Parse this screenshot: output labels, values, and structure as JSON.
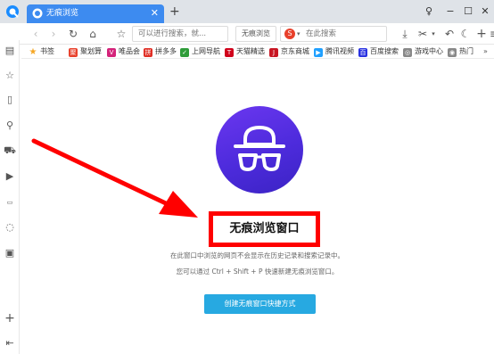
{
  "tab": {
    "title": "无痕浏览"
  },
  "toolbar": {
    "address_placeholder": "可以进行搜索，就...",
    "privacy_label": "无痕浏览",
    "search_placeholder": "在此搜索",
    "search_engine_glyph": "S"
  },
  "bookmarks": [
    {
      "label": "书签",
      "color": "#f5a623"
    },
    {
      "label": "聚划算",
      "color": "#e8402b"
    },
    {
      "label": "唯品会",
      "color": "#d4237a"
    },
    {
      "label": "拼多多",
      "color": "#e02e24"
    },
    {
      "label": "上网导航",
      "color": "#2f9c3a"
    },
    {
      "label": "天猫精选",
      "color": "#d0021b"
    },
    {
      "label": "京东商城",
      "color": "#c81623"
    },
    {
      "label": "腾讯视频",
      "color": "#20a0ff"
    },
    {
      "label": "百度搜索",
      "color": "#2932e1"
    },
    {
      "label": "游戏中心",
      "color": "#888888"
    },
    {
      "label": "热门",
      "color": "#888888"
    }
  ],
  "main": {
    "headline": "无痕浏览窗口",
    "desc1": "在此窗口中浏览的网页不会显示在历史记录和搜索记录中。",
    "desc2": "您可以通过 Ctrl + Shift + P 快速新建无痕浏览窗口。",
    "cta_label": "创建无痕窗口快捷方式"
  },
  "colors": {
    "tab_active": "#3d8bf0",
    "avatar": "#5a2fe6",
    "highlight": "#ff0000",
    "cta": "#27a9e1"
  }
}
